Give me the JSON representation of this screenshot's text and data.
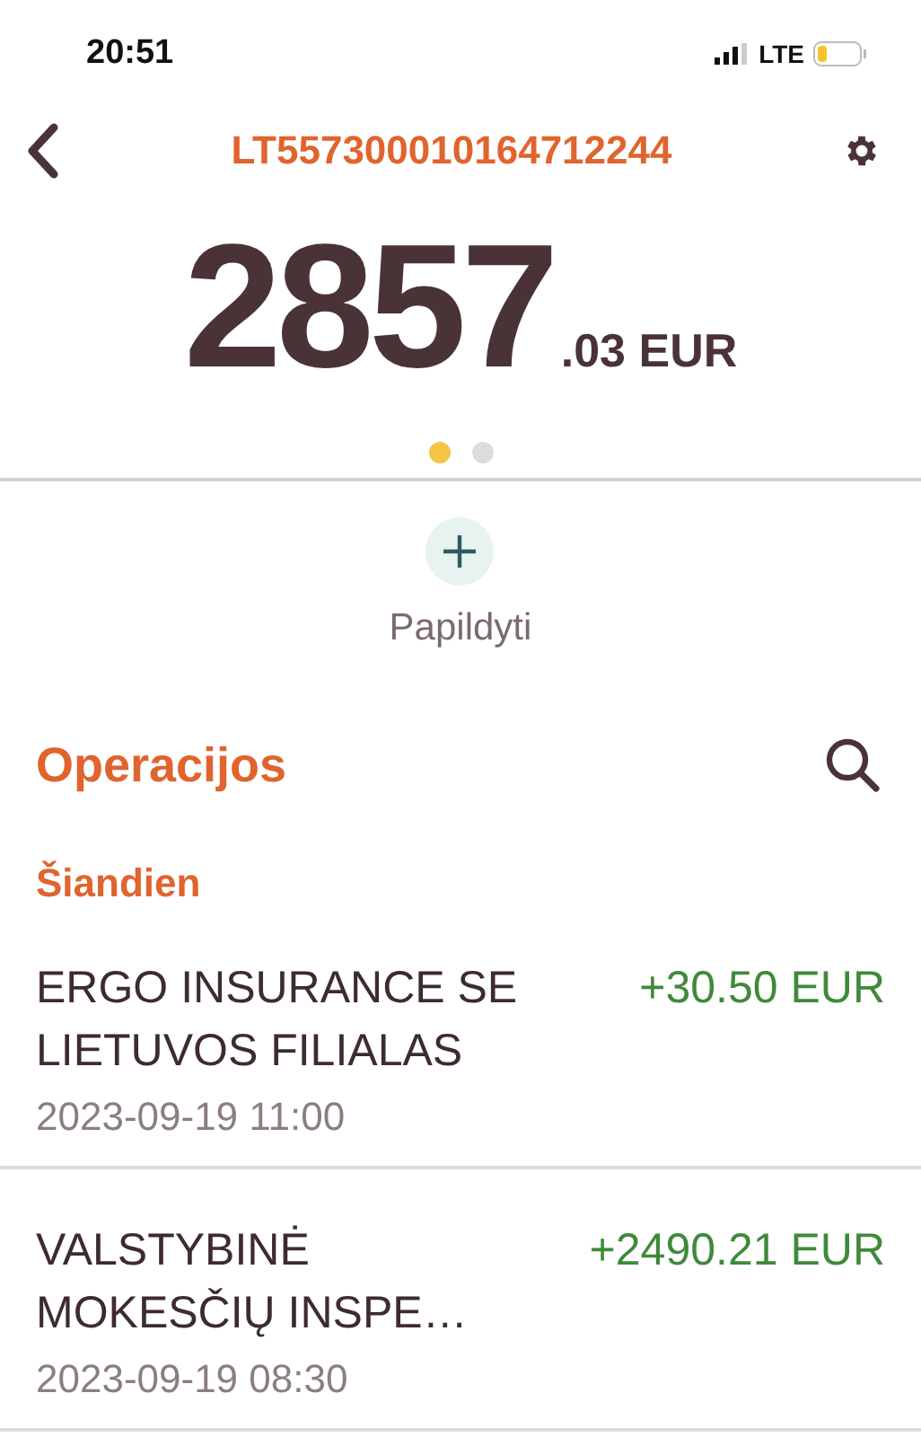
{
  "status_bar": {
    "time": "20:51",
    "network": "LTE"
  },
  "header": {
    "title": "LT557300010164712244"
  },
  "balance": {
    "whole": "2857",
    "fraction": ".03 EUR"
  },
  "pager": [
    {
      "selected": true
    },
    {
      "selected": false
    }
  ],
  "actions": [
    {
      "label": "Papildyti"
    }
  ],
  "operations": {
    "title": "Operacijos",
    "group": "Šiandien",
    "items": [
      {
        "name_lines": [
          "ERGO INSURANCE SE",
          "LIETUVOS FILIALAS"
        ],
        "amount": "+30.50 EUR",
        "date": "2023-09-19 11:00"
      },
      {
        "name_lines": [
          "VALSTYBINĖ",
          "MOKESČIŲ INSPE…"
        ],
        "amount": "+2490.21 EUR",
        "date": "2023-09-19 08:30"
      }
    ]
  }
}
